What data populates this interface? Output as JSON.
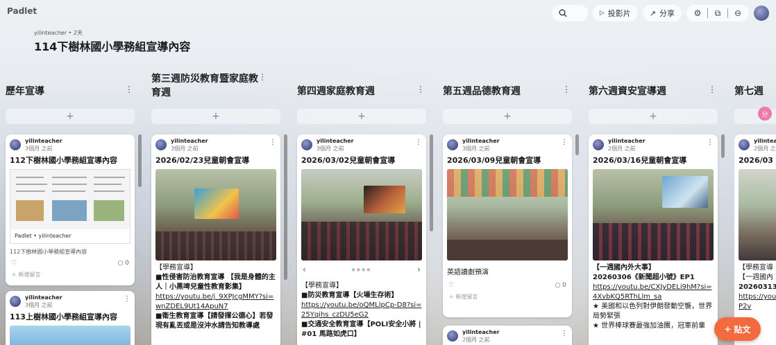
{
  "app": {
    "logo": "Padlet"
  },
  "topbar": {
    "search_icon": "search-icon",
    "slideshow_label": "投影片",
    "share_label": "分享"
  },
  "board": {
    "author_line": "yilinteacher • 2天",
    "title": "114下樹林國小學務組宣導內容"
  },
  "columns": [
    {
      "title": "歷年宣導"
    },
    {
      "title": "第三週防災教育暨家庭教育週"
    },
    {
      "title": "第四週家庭教育週"
    },
    {
      "title": "第五週品德教育週"
    },
    {
      "title": "第六週資安宣導週"
    },
    {
      "title": "第七週"
    }
  ],
  "add_symbol": "+",
  "cards": {
    "c1": {
      "author": "yilinteacher",
      "time": "3個月 之前",
      "title": "112下樹林國小學務組宣導內容",
      "link_source": "Padlet • yilinteacher",
      "link_text": "112下樹林國小學務組宣導內容",
      "comment_count": "0",
      "add_comment": "新增留言"
    },
    "c1b": {
      "author": "yilinteacher",
      "time": "3個月 之前",
      "title": "113上樹林國小學務組宣導內容"
    },
    "c2": {
      "author": "yilinteacher",
      "time": "3個月 之前",
      "title": "2026/02/23兒童朝會宣導",
      "line1": "【學務宣導】",
      "line2": "■性侵害防治教育宣導 【我是身體的主人｜小黑啤兒童性教育影集】",
      "link1": "https://youtu.be/j_9XPJcgMMY?si=wnZDEL9Ut14ApuN7",
      "line3": "■衛生教育宣導【請發揮公德心】若發現有亂丟或是沒沖水請告知教導處"
    },
    "c3": {
      "author": "yilinteacher",
      "time": "3個月 之前",
      "title": "2026/03/02兒童朝會宣導",
      "line1": "【學務宣導】",
      "line2": "■防災教育宣導【火場生存術】",
      "link1": "https://youtu.be/oQMLlpCp-D8?si=25Yqihs_czDU5eG2",
      "line3": "■交通安全教育宣導【POLI安全小將 | #01 馬路如虎口】"
    },
    "c4": {
      "author": "yilinteacher",
      "time": "3個月 之前",
      "title": "2026/03/09兒童朝會宣導",
      "caption": "英語讀劇預演",
      "comment_count": "0",
      "add_comment": "新增留言"
    },
    "c4b": {
      "author": "yilinteacher",
      "time": "2個月 之前"
    },
    "c5": {
      "author": "yilinteacher",
      "time": "2個月 之前",
      "title": "2026/03/16兒童朝會宣導",
      "line1": "【一週國內外大事】",
      "line2": "20260306《新聞超小號》EP1",
      "link1": "https://youtu.be/CXJyDELi9hM?si=4XvbKQ5RThLlm_sa",
      "line3": "★ 美國和以色列對伊朗發動空襲，世界局勢緊張",
      "line4": "★ 世界棒球賽最強加油團，冠軍前輩"
    },
    "c6": {
      "author": "yilinteacher",
      "time": "2個月 之前",
      "title": "2026/03",
      "line1": "【學務宣導",
      "line2": "【一週國內",
      "line3": "20260313",
      "link1": "https://you",
      "link2": "P2v"
    }
  },
  "fab": {
    "label": "貼文",
    "plus": "+"
  },
  "badge": "分"
}
